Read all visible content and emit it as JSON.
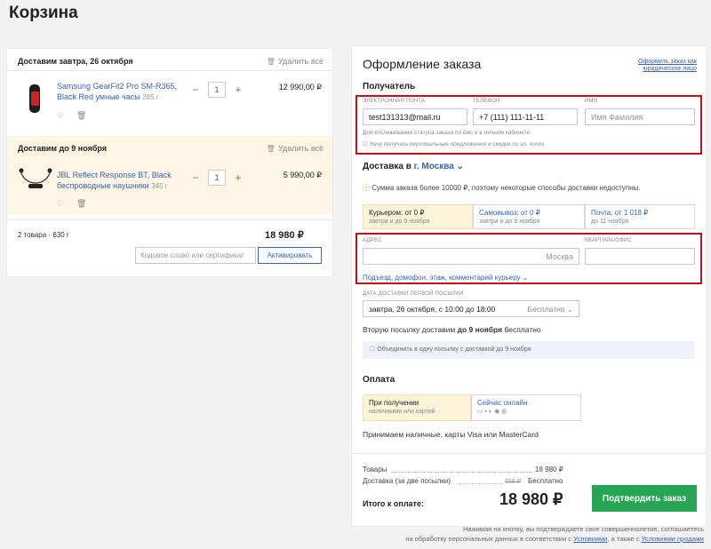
{
  "page": {
    "title": "Корзина"
  },
  "cart": {
    "groups": [
      {
        "heading": "Доставим завтра, 26 октября",
        "delete_all": "Удалить всё",
        "product": {
          "name": "Samsung GearFit2 Pro SM-R365, Black Red умные часы",
          "weight": "285 г",
          "qty": "1",
          "price": "12 990,00 ₽"
        }
      },
      {
        "heading": "Доставим до 9 ноября",
        "delete_all": "Удалить всё",
        "product": {
          "name": "JBL Reflect Response BT, Black беспроводные наушники",
          "weight": "345 г",
          "qty": "1",
          "price": "5 990,00 ₽"
        }
      }
    ],
    "summary": {
      "count": "2 товара · 630 г",
      "total": "18 980 ₽"
    },
    "promo": {
      "placeholder": "Кодовое слово или сертификат",
      "activate": "Активировать"
    }
  },
  "order": {
    "title": "Оформление заказа",
    "legal_link": "Оформить заказ как юридическое лицо",
    "recipient": {
      "heading": "Получатель",
      "email_label": "Электронная почта",
      "email_value": "test131313@mail.ru",
      "phone_label": "Телефон",
      "phone_value": "+7 (111) 111-11-11",
      "name_label": "Имя",
      "name_placeholder": "Имя Фамилия",
      "hint": "Для отслеживания статуса заказа по смс и в личном кабинете",
      "checkbox": "Хочу получать персональные предложения и скидки по эл. почте"
    },
    "delivery": {
      "heading": "Доставка в",
      "city": "г. Москва",
      "notice": "Сумма заказа более 10000 ₽, поэтому некоторые способы доставки недоступны.",
      "options": [
        {
          "label": "Курьером: от 0 ₽",
          "sub": "завтра и до 9 ноября"
        },
        {
          "label": "Самовывоз: от 0 ₽",
          "sub": "завтра и до 9 ноября"
        },
        {
          "label": "Почта: от 1 018 ₽",
          "sub": "до 11 ноября"
        }
      ],
      "address_label": "Адрес",
      "address_city": "Москва",
      "apt_label": "Квартира/офис",
      "courier_comment": "Подъезд, домофон, этаж, комментарий курьеру",
      "first_date_label": "Дата доставки первой посылки",
      "first_date_value": "завтра, 26 октября, с 10:00 до 18:00",
      "first_date_price": "Бесплатно",
      "second_text_pre": "Вторую посылку доставим",
      "second_text_bold": "до 9 ноября",
      "second_text_post": "бесплатно",
      "combine": "Объединить в одну посылку с доставкой до 9 ноября"
    },
    "payment": {
      "heading": "Оплата",
      "options": [
        {
          "label": "При получении",
          "sub": "наличными или картой"
        },
        {
          "label": "Сейчас онлайн",
          "sub": ""
        }
      ],
      "note": "Принимаем наличные, карты Visa или MasterCard"
    },
    "totals": {
      "goods_label": "Товары",
      "goods_value": "18 980 ₽",
      "delivery_label": "Доставка (за две посылки)",
      "delivery_old": "658 ₽",
      "delivery_value": "Бесплатно",
      "total_label": "Итого к оплате:",
      "total_value": "18 980 ₽",
      "confirm": "Подтвердить заказ"
    }
  },
  "footer": {
    "line1": "Нажимая на кнопку, вы подтверждаете свое совершеннолетие, соглашаетесь",
    "line2_pre": "на обработку персональных данных в соответствии с",
    "link1": "Условиями",
    "line2_mid": ", а также с",
    "link2": "Условиями продажи"
  },
  "colors": {
    "accent": "#3b63b8",
    "green": "#28a455",
    "highlight": "#fdf3d9",
    "red_outline": "#c2101c"
  }
}
